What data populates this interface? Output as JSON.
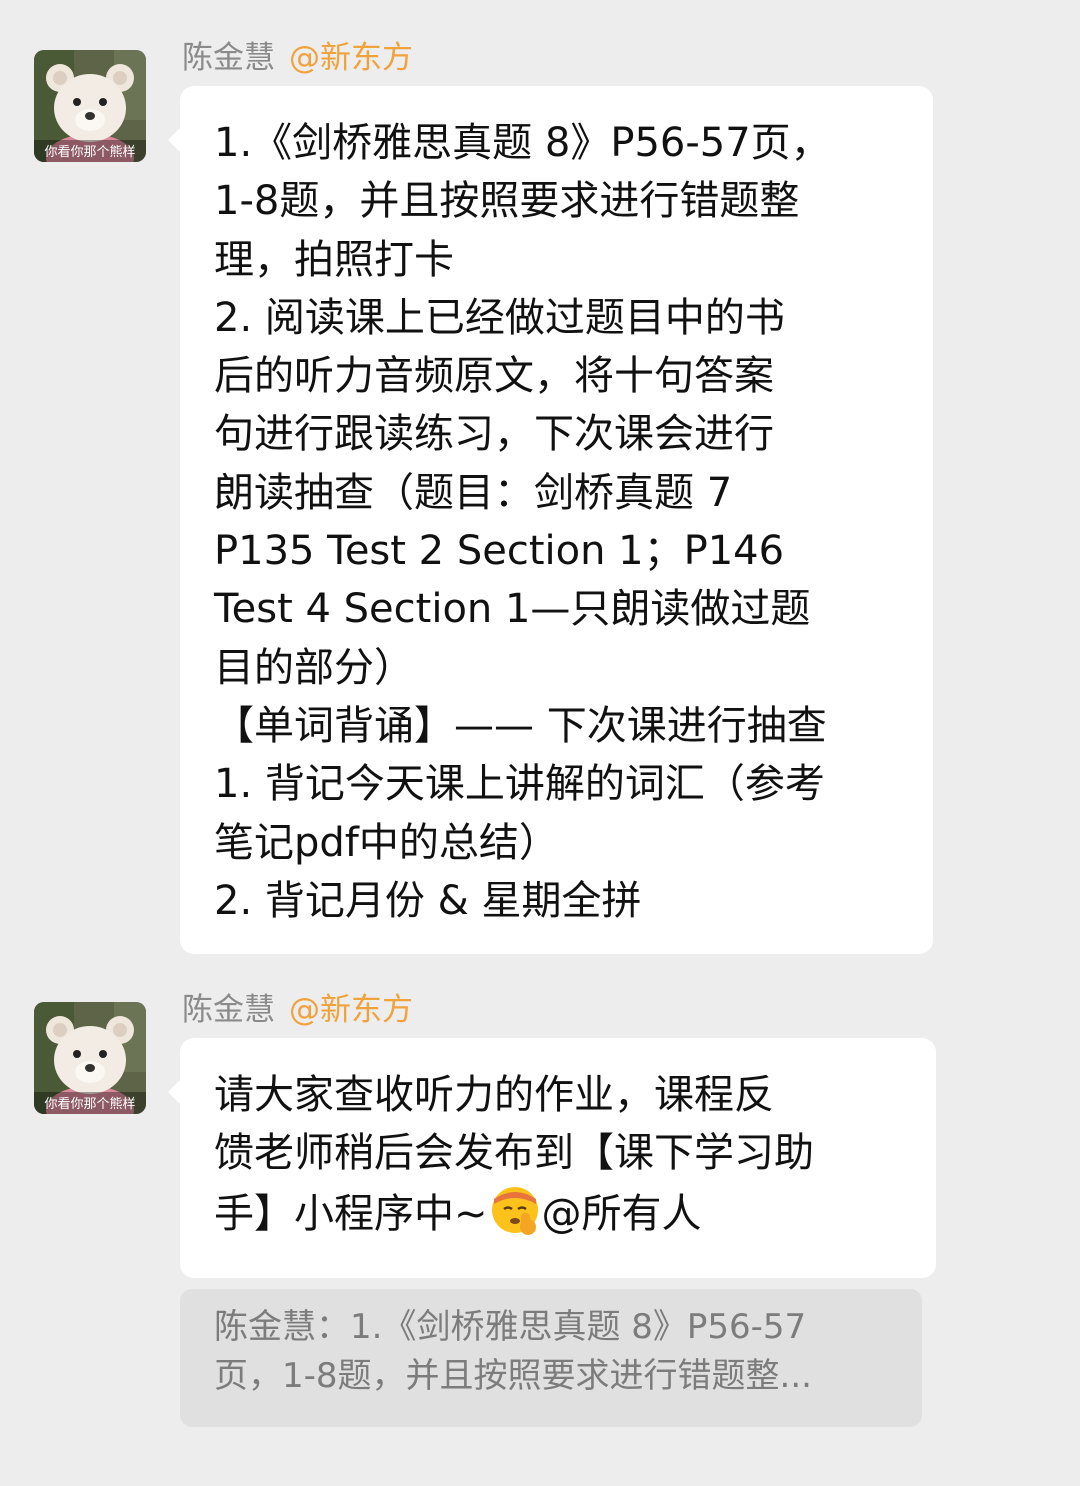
{
  "messages": [
    {
      "sender": "陈金慧",
      "tag": "@新东方",
      "avatar": {
        "icon": "teddy-bear-avatar-icon",
        "caption": "你看你那个熊样"
      },
      "lines": [
        "1.《剑桥雅思真题 8》P56-57页，",
        "1-8题，并且按照要求进行错题整",
        "理，拍照打卡",
        "2. 阅读课上已经做过题目中的书",
        "后的听力音频原文，将十句答案",
        "句进行跟读练习，下次课会进行",
        "朗读抽查（题目：剑桥真题 7",
        "P135 Test 2 Section 1；P146",
        "Test 4 Section 1—只朗读做过题",
        "目的部分）",
        "【单词背诵】—— 下次课进行抽查",
        "1. 背记今天课上讲解的词汇（参考",
        "笔记pdf中的总结）",
        "2. 背记月份 & 星期全拼"
      ]
    },
    {
      "sender": "陈金慧",
      "tag": "@新东方",
      "avatar": {
        "icon": "teddy-bear-avatar-icon",
        "caption": "你看你那个熊样"
      },
      "lines": [
        "请大家查收听力的作业，课程反",
        "馈老师稍后会发布到【课下学习助"
      ],
      "last_line_before_emoji": "手】小程序中~",
      "emoji": "shushing-face-emoji-icon",
      "last_line_after_emoji": "@所有人"
    }
  ],
  "quote": {
    "lines": [
      "陈金慧：1.《剑桥雅思真题 8》P56-57",
      "页，1-8题，并且按照要求进行错题整..."
    ]
  },
  "colors": {
    "background": "#ededed",
    "bubble": "#ffffff",
    "sender_name": "#8a8a8a",
    "sender_tag": "#f0a23c",
    "quote_background": "#e0e0e0",
    "quote_text": "#7c7c7c"
  }
}
